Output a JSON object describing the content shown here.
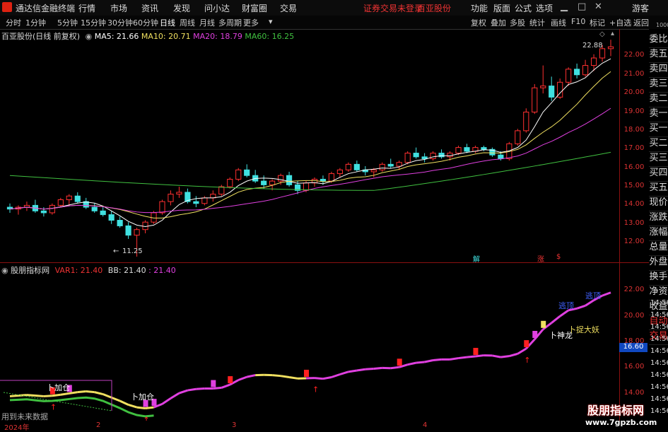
{
  "app": {
    "title": "通达信金融终端",
    "menus": [
      "行情",
      "市场",
      "资讯",
      "发现",
      "问小达",
      "财富圈",
      "交易"
    ],
    "warning": "证券交易未登录",
    "stock_name": "百亚股份",
    "right_menus": [
      "功能",
      "版面",
      "公式",
      "选项"
    ],
    "guest": "游客",
    "window_controls": [
      "minimize-icon",
      "maximize-icon",
      "close-icon"
    ]
  },
  "toolbar": {
    "periods": [
      "分时",
      "1分钟",
      "5分钟",
      "15分钟",
      "30分钟",
      "60分钟",
      "日线",
      "周线",
      "月线",
      "多周期",
      "更多"
    ],
    "active_period": "日线",
    "right_buttons": [
      "复权",
      "叠加",
      "多股",
      "统计",
      "画线",
      "F10",
      "标记",
      "+自选",
      "返回"
    ]
  },
  "main_chart": {
    "header": "百亚股份(日线 前复权)",
    "ma": [
      {
        "label": "MA5: 21.66",
        "color": "#ffffff"
      },
      {
        "label": "MA10: 20.71",
        "color": "#f0e060"
      },
      {
        "label": "MA20: 18.79",
        "color": "#e040e0"
      },
      {
        "label": "MA60: 16.25",
        "color": "#40c040"
      }
    ],
    "high_label": "22.88",
    "low_label": "11.25",
    "y_ticks": [
      "22.00",
      "21.00",
      "20.00",
      "19.00",
      "18.00",
      "17.00",
      "16.00",
      "15.00",
      "14.00",
      "13.00",
      "12.00"
    ],
    "y_min": 11.4,
    "y_max": 23.0,
    "markers": [
      "解",
      "涨",
      "$"
    ]
  },
  "sub_chart": {
    "header": "股朋指标网",
    "var1": "VAR1: 21.40",
    "bb": "BB: 21.40",
    "bb_val": ": 21.40",
    "y_ticks": [
      "22.00",
      "20.00",
      "18.00",
      "16.00",
      "14.00"
    ],
    "current_value": "16.60",
    "annotations": [
      "卜加仓",
      "卜加仓",
      "卜神龙",
      "卜捉大妖",
      "逃顶",
      "逃顶"
    ],
    "bottom_note": "用到未来数据"
  },
  "right_panel": {
    "top_label": "1000",
    "items": [
      "委比",
      "卖五",
      "卖四",
      "卖三",
      "卖二",
      "卖一",
      "买一",
      "买二",
      "买三",
      "买四",
      "买五",
      "现价",
      "涨跌",
      "涨幅",
      "总量",
      "外盘",
      "换手",
      "净资",
      "收益",
      "自动",
      "交易"
    ],
    "times": [
      "14:56",
      "14:56",
      "14:56",
      "14:56",
      "14:56",
      "14:56",
      "14:56",
      "14:56",
      "14:56",
      "14:56"
    ]
  },
  "x_axis": {
    "labels": [
      "2024年",
      "2",
      "3",
      "4"
    ]
  },
  "watermark": {
    "text": "股朋指标网",
    "url": "www.7gpzb.com"
  },
  "colors": {
    "up": "#ff3030",
    "down": "#40e0e0",
    "accent": "#d21"
  },
  "chart_data": {
    "type": "candlestick",
    "ohlc": [
      [
        13.9,
        14.1,
        13.6,
        13.8
      ],
      [
        13.8,
        14.0,
        13.5,
        13.9
      ],
      [
        13.9,
        14.2,
        13.7,
        14.0
      ],
      [
        14.0,
        14.3,
        13.6,
        13.7
      ],
      [
        13.7,
        13.9,
        13.4,
        13.6
      ],
      [
        13.6,
        14.1,
        13.5,
        14.0
      ],
      [
        14.0,
        14.4,
        13.9,
        14.3
      ],
      [
        14.3,
        14.6,
        14.0,
        14.5
      ],
      [
        14.5,
        14.7,
        14.1,
        14.2
      ],
      [
        14.2,
        14.4,
        13.8,
        13.9
      ],
      [
        13.9,
        14.1,
        13.6,
        13.7
      ],
      [
        13.7,
        13.9,
        13.4,
        13.5
      ],
      [
        13.5,
        13.7,
        13.0,
        13.2
      ],
      [
        13.2,
        13.4,
        12.8,
        12.9
      ],
      [
        12.9,
        13.1,
        12.2,
        12.4
      ],
      [
        12.4,
        12.8,
        11.25,
        12.7
      ],
      [
        12.7,
        13.2,
        12.5,
        13.1
      ],
      [
        13.1,
        13.7,
        13.0,
        13.6
      ],
      [
        13.6,
        14.3,
        13.5,
        14.2
      ],
      [
        14.2,
        14.8,
        14.0,
        14.6
      ],
      [
        14.6,
        15.0,
        14.4,
        14.7
      ],
      [
        14.7,
        14.9,
        14.1,
        14.2
      ],
      [
        14.2,
        14.5,
        13.9,
        14.1
      ],
      [
        14.1,
        14.5,
        14.0,
        14.4
      ],
      [
        14.4,
        14.8,
        14.2,
        14.6
      ],
      [
        14.6,
        15.1,
        14.5,
        15.0
      ],
      [
        15.0,
        15.5,
        14.9,
        15.4
      ],
      [
        15.4,
        16.0,
        15.3,
        15.9
      ],
      [
        15.9,
        16.2,
        15.5,
        15.6
      ],
      [
        15.6,
        15.9,
        15.2,
        15.3
      ],
      [
        15.3,
        15.6,
        14.9,
        15.1
      ],
      [
        15.1,
        15.4,
        14.8,
        15.3
      ],
      [
        15.3,
        15.7,
        15.1,
        15.6
      ],
      [
        15.6,
        15.8,
        15.0,
        15.1
      ],
      [
        15.1,
        15.3,
        14.6,
        14.8
      ],
      [
        14.8,
        15.3,
        14.7,
        15.2
      ],
      [
        15.2,
        15.5,
        15.0,
        15.4
      ],
      [
        15.4,
        15.6,
        15.1,
        15.3
      ],
      [
        15.3,
        15.8,
        15.2,
        15.7
      ],
      [
        15.7,
        16.0,
        15.5,
        15.9
      ],
      [
        15.9,
        16.3,
        15.8,
        16.2
      ],
      [
        16.2,
        16.4,
        15.8,
        15.9
      ],
      [
        15.9,
        16.1,
        15.6,
        15.8
      ],
      [
        15.8,
        16.0,
        15.5,
        15.9
      ],
      [
        15.9,
        16.3,
        15.8,
        16.2
      ],
      [
        16.2,
        16.5,
        16.0,
        16.1
      ],
      [
        16.1,
        16.4,
        15.9,
        16.3
      ],
      [
        16.3,
        16.9,
        16.2,
        16.8
      ],
      [
        16.8,
        17.1,
        16.5,
        16.6
      ],
      [
        16.6,
        16.8,
        16.3,
        16.5
      ],
      [
        16.5,
        16.9,
        16.4,
        16.8
      ],
      [
        16.8,
        17.0,
        16.5,
        16.6
      ],
      [
        16.6,
        16.9,
        16.4,
        16.8
      ],
      [
        16.8,
        17.2,
        16.7,
        17.1
      ],
      [
        17.1,
        17.3,
        16.8,
        16.9
      ],
      [
        16.9,
        17.2,
        16.8,
        17.1
      ],
      [
        17.1,
        17.2,
        16.9,
        17.0
      ],
      [
        17.0,
        17.1,
        16.6,
        16.7
      ],
      [
        16.7,
        16.9,
        16.4,
        16.5
      ],
      [
        16.5,
        17.4,
        16.4,
        17.3
      ],
      [
        17.3,
        18.1,
        17.2,
        18.0
      ],
      [
        18.0,
        19.2,
        17.9,
        19.0
      ],
      [
        19.0,
        20.5,
        18.9,
        20.3
      ],
      [
        20.3,
        21.5,
        20.0,
        20.4
      ],
      [
        20.4,
        20.9,
        19.6,
        19.8
      ],
      [
        19.8,
        20.8,
        19.7,
        20.6
      ],
      [
        20.6,
        21.4,
        20.4,
        21.3
      ],
      [
        21.3,
        21.6,
        20.8,
        21.0
      ],
      [
        21.0,
        21.8,
        20.9,
        21.5
      ],
      [
        21.5,
        22.1,
        21.2,
        21.9
      ],
      [
        21.9,
        22.6,
        21.7,
        22.4
      ],
      [
        22.4,
        22.88,
        22.0,
        22.5
      ]
    ]
  }
}
